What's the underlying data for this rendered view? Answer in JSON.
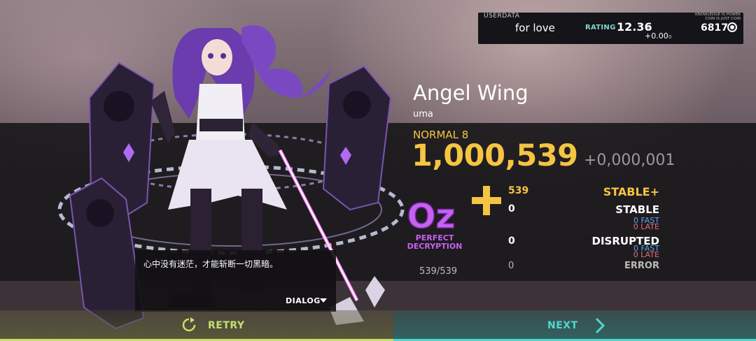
{
  "user": {
    "section_label": "USERDATA",
    "name": "for love",
    "rating_label": "RATING",
    "rating_value": "12.36",
    "rating_value_sub": "5",
    "rating_delta": "+0.00",
    "rating_delta_sub": "0",
    "slogan": "KNOWLEDGE IS POWER COIN IS JUST COIN",
    "coins": "6817",
    "coin_icon": "coin-icon"
  },
  "song": {
    "title": "Angel Wing",
    "artist": "uma",
    "difficulty": "NORMAL 8",
    "score": "1,000,539",
    "score_delta": "+0,000,001"
  },
  "rank": {
    "grade": "Oz",
    "grade_caption_line1": "PERFECT",
    "grade_caption_line2": "DECRYPTION"
  },
  "judgements": {
    "stable_plus": {
      "label": "STABLE+",
      "count": "539"
    },
    "stable": {
      "label": "STABLE",
      "count": "0",
      "fast": "0 FAST",
      "late": "0 LATE"
    },
    "disrupted": {
      "label": "DISRUPTED",
      "count": "0",
      "fast": "0 FAST",
      "late": "0 LATE"
    },
    "error": {
      "label": "ERROR",
      "count": "0"
    },
    "total": "539/539"
  },
  "dialog": {
    "text": "心中没有迷茫，才能斩断一切黑暗。",
    "tab_label": "DIALOG"
  },
  "buttons": {
    "retry": "RETRY",
    "next": "NEXT"
  },
  "colors": {
    "gold": "#f5c542",
    "retry_accent": "#c6e06a",
    "next_accent": "#4fd8d0",
    "rank_purple": "#c861f0",
    "fast": "#56a7e8",
    "late": "#e36d76"
  }
}
